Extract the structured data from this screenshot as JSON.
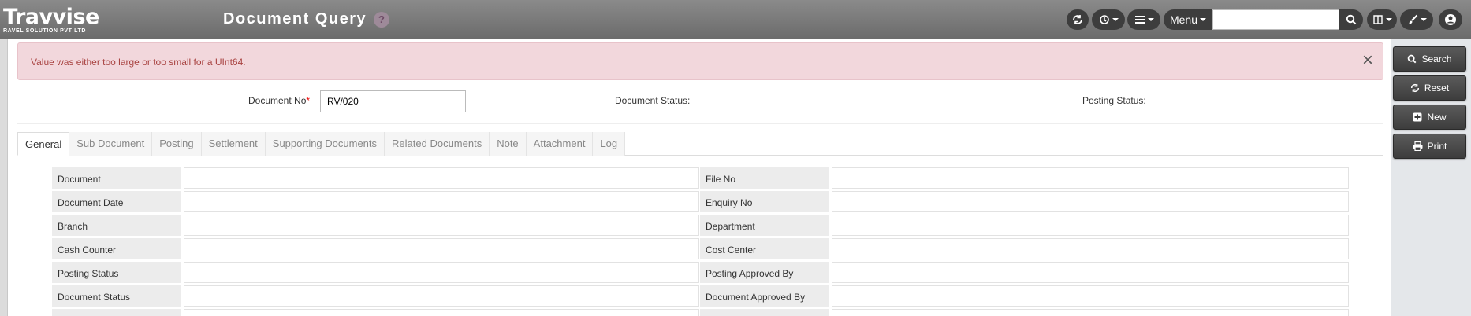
{
  "header": {
    "logo_main": "Travvise",
    "logo_sub": "RAVEL SOLUTION PVT LTD",
    "title": "Document Query",
    "help": "?",
    "menu_label": "Menu",
    "search_placeholder": ""
  },
  "alert": {
    "message": "Value was either too large or too small for a UInt64.",
    "close": "×"
  },
  "doc_bar": {
    "doc_no_label": "Document No",
    "doc_no_required": "*",
    "doc_no_value": "RV/020",
    "doc_status_label": "Document Status:",
    "posting_status_label": "Posting Status:"
  },
  "tabs": [
    {
      "label": "General"
    },
    {
      "label": "Sub Document"
    },
    {
      "label": "Posting"
    },
    {
      "label": "Settlement"
    },
    {
      "label": "Supporting Documents"
    },
    {
      "label": "Related Documents"
    },
    {
      "label": "Note"
    },
    {
      "label": "Attachment"
    },
    {
      "label": "Log"
    }
  ],
  "grid": [
    {
      "left": "Document",
      "right": "File No"
    },
    {
      "left": "Document Date",
      "right": "Enquiry No"
    },
    {
      "left": "Branch",
      "right": "Department"
    },
    {
      "left": "Cash Counter",
      "right": "Cost Center"
    },
    {
      "left": "Posting Status",
      "right": "Posting Approved By"
    },
    {
      "left": "Document Status",
      "right": "Document Approved By"
    },
    {
      "left": "",
      "right": ""
    }
  ],
  "side_buttons": {
    "search": "Search",
    "reset": "Reset",
    "new": "New",
    "print": "Print"
  },
  "colors": {
    "header": "#777777",
    "alert_bg": "#f2d7dc",
    "alert_text": "#a94442",
    "button_dark": "#3d3d3d"
  },
  "icons": [
    "refresh-icon",
    "history-icon",
    "list-icon",
    "search-icon",
    "book-icon",
    "paintbrush-icon",
    "user-icon",
    "rotate-icon",
    "plus-square-icon",
    "print-icon",
    "close-icon"
  ]
}
